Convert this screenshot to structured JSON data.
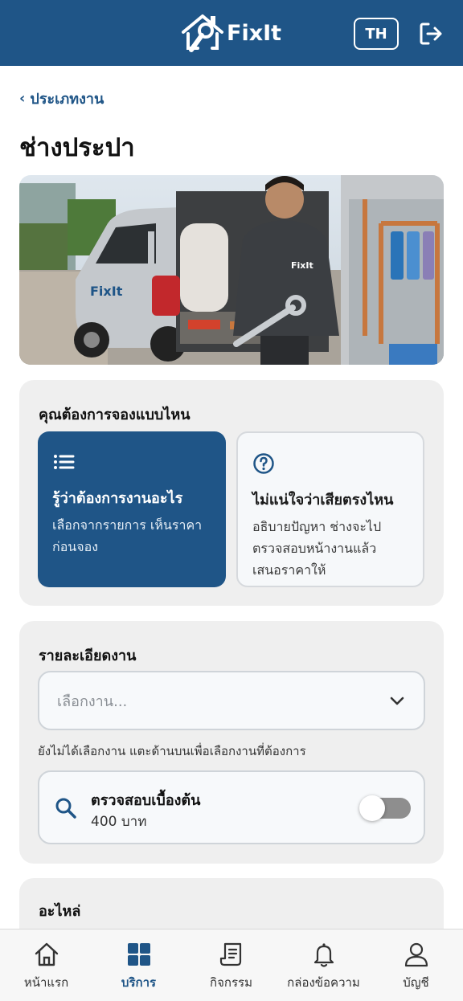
{
  "header": {
    "brand": "FixIt",
    "language_button": "TH",
    "logout_icon": "logout-icon",
    "color": "#1f5587"
  },
  "breadcrumb": {
    "back_label": "ประเภทงาน"
  },
  "page": {
    "title": "ช่างประปา"
  },
  "hero": {
    "brand_on_truck": "FixIt",
    "brand_on_jacket": "FixIt"
  },
  "booking_mode": {
    "title": "คุณต้องการจองแบบไหน",
    "options": [
      {
        "icon": "list-icon",
        "title": "รู้ว่าต้องการงานอะไร",
        "description_lines": [
          "เลือกจากรายการ เห็นราคา",
          "ก่อนจอง"
        ],
        "selected": true
      },
      {
        "icon": "question-circle-icon",
        "title": "ไม่แน่ใจว่าเสียตรงไหน",
        "description_lines": [
          "อธิบายปัญหา ช่างจะไป",
          "ตรวจสอบหน้างานแล้ว",
          "เสนอราคาให้"
        ],
        "selected": false
      }
    ]
  },
  "job_details": {
    "title": "รายละเอียดงาน",
    "select_placeholder": "เลือกงาน...",
    "hint": "ยังไม่ได้เลือกงาน แตะด้านบนเพื่อเลือกงานที่ต้องการ",
    "inspection": {
      "icon": "search-icon",
      "title": "ตรวจสอบเบื้องต้น",
      "price": "400 บาท",
      "enabled": false
    }
  },
  "parts": {
    "title": "อะไหล่"
  },
  "bottom_nav": [
    {
      "icon": "home-icon",
      "label": "หน้าแรก",
      "active": false
    },
    {
      "icon": "grid-icon",
      "label": "บริการ",
      "active": true
    },
    {
      "icon": "document-icon",
      "label": "กิจกรรม",
      "active": false
    },
    {
      "icon": "bell-icon",
      "label": "กล่องข้อความ",
      "active": false
    },
    {
      "icon": "user-icon",
      "label": "บัญชี",
      "active": false
    }
  ]
}
